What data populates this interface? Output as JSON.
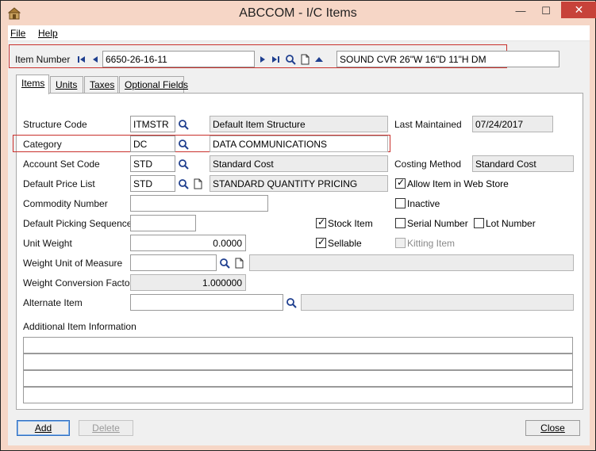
{
  "window": {
    "title": "ABCCOM - I/C Items",
    "minimize_glyph": "—",
    "maximize_glyph": "☐",
    "close_glyph": "✕"
  },
  "menu": {
    "file": "File",
    "help": "Help"
  },
  "item": {
    "label": "Item Number",
    "number": "6650-26-16-11",
    "description": "SOUND CVR 26\"W 16\"D 11\"H DM"
  },
  "tabs": [
    {
      "label": "Items",
      "active": true
    },
    {
      "label": "Units",
      "active": false
    },
    {
      "label": "Taxes",
      "active": false
    },
    {
      "label": "Optional Fields",
      "active": false
    }
  ],
  "form": {
    "structure_code": {
      "label": "Structure Code",
      "value": "ITMSTR",
      "description": "Default Item Structure"
    },
    "last_maintained": {
      "label": "Last Maintained",
      "value": "07/24/2017"
    },
    "category": {
      "label": "Category",
      "value": "DC",
      "description": "DATA COMMUNICATIONS"
    },
    "account_set_code": {
      "label": "Account Set Code",
      "value": "STD",
      "description": "Standard Cost"
    },
    "costing_method": {
      "label": "Costing Method",
      "value": "Standard Cost"
    },
    "default_price_list": {
      "label": "Default Price List",
      "value": "STD",
      "description": "STANDARD QUANTITY PRICING"
    },
    "allow_web_store": {
      "label": "Allow Item in Web Store",
      "checked": true
    },
    "commodity_number": {
      "label": "Commodity Number",
      "value": ""
    },
    "inactive": {
      "label": "Inactive",
      "checked": false
    },
    "default_picking_sequence": {
      "label": "Default Picking Sequence",
      "value": ""
    },
    "stock_item": {
      "label": "Stock Item",
      "checked": true
    },
    "serial_number": {
      "label": "Serial Number",
      "checked": false
    },
    "lot_number": {
      "label": "Lot Number",
      "checked": false
    },
    "unit_weight": {
      "label": "Unit Weight",
      "value": "0.0000"
    },
    "sellable": {
      "label": "Sellable",
      "checked": true
    },
    "kitting_item": {
      "label": "Kitting Item",
      "checked": false,
      "disabled": true
    },
    "weight_uom": {
      "label": "Weight Unit of Measure",
      "value": "",
      "description": ""
    },
    "weight_conversion_factor": {
      "label": "Weight Conversion Factor",
      "value": "1.000000"
    },
    "alternate_item": {
      "label": "Alternate Item",
      "value": "",
      "description": ""
    },
    "additional_info": {
      "label": "Additional Item Information",
      "lines": [
        "",
        "",
        "",
        ""
      ]
    }
  },
  "buttons": {
    "add": "Add",
    "delete": "Delete",
    "close": "Close"
  },
  "icons": {
    "app": "warehouse-app-icon",
    "first": "first-record-icon",
    "prev": "previous-record-icon",
    "next": "next-record-icon",
    "last": "last-record-icon",
    "finder": "magnifier-icon",
    "new": "new-document-icon",
    "up": "zoom-up-icon"
  },
  "colors": {
    "title_bar": "#f6d6c6",
    "close_button": "#c7423a",
    "highlight_box": "#c9302c",
    "nav_arrow": "#1f3f8f"
  }
}
